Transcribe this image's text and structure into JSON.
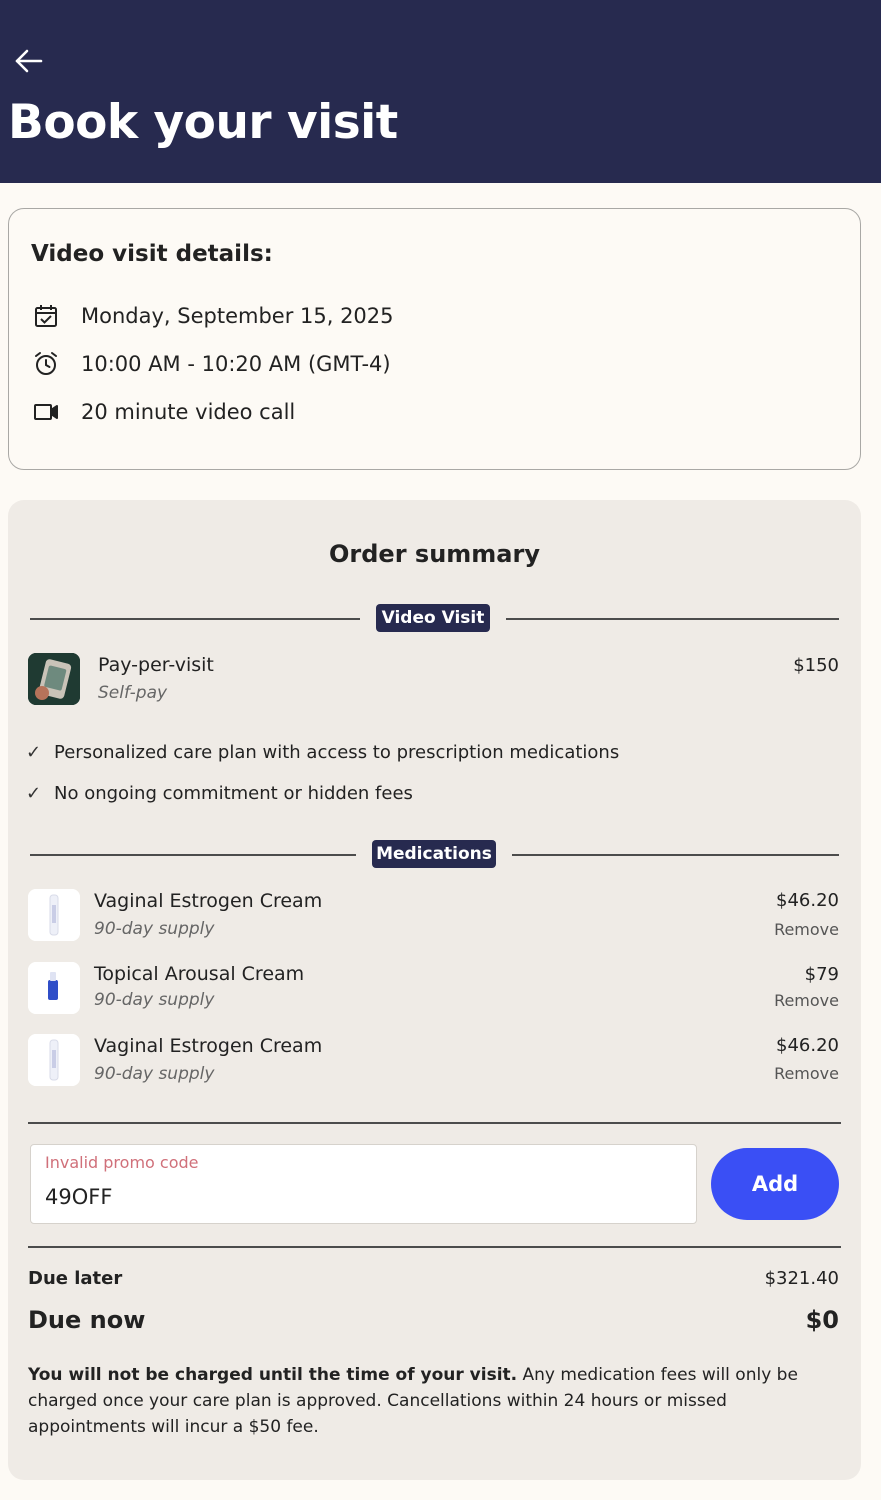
{
  "header": {
    "title": "Book your visit"
  },
  "visit_details": {
    "heading": "Video visit details:",
    "date": "Monday, September 15, 2025",
    "time": "10:00 AM - 10:20 AM (GMT-4)",
    "duration": "20 minute video call"
  },
  "order_summary": {
    "title": "Order summary",
    "video_visit_section": {
      "label": "Video Visit",
      "item": {
        "name": "Pay-per-visit",
        "sub": "Self-pay",
        "price": "$150"
      },
      "benefits": [
        "Personalized care plan with access to prescription medications",
        "No ongoing commitment or hidden fees"
      ]
    },
    "medications_section": {
      "label": "Medications",
      "items": [
        {
          "name": "Vaginal Estrogen Cream",
          "sub": "90-day supply",
          "price": "$46.20",
          "remove": "Remove"
        },
        {
          "name": "Topical Arousal Cream",
          "sub": "90-day supply",
          "price": "$79",
          "remove": "Remove"
        },
        {
          "name": "Vaginal Estrogen Cream",
          "sub": "90-day supply",
          "price": "$46.20",
          "remove": "Remove"
        }
      ]
    },
    "promo": {
      "error": "Invalid promo code",
      "value": "49OFF",
      "add_label": "Add"
    },
    "due_later": {
      "label": "Due later",
      "value": "$321.40"
    },
    "due_now": {
      "label": "Due now",
      "value": "$0"
    },
    "notice": {
      "bold": "You will not be charged until the time of your visit.",
      "rest": " Any medication fees will only be charged once your care plan is approved. Cancellations within 24 hours or missed appointments will incur a $50 fee."
    }
  },
  "colors": {
    "header_bg": "#272a4f",
    "page_bg": "#fdfaf5",
    "summary_bg": "#efebe6",
    "accent_button": "#3a4ff5",
    "error_text": "#d0707a"
  },
  "icons": [
    "back-arrow-icon",
    "calendar-icon",
    "alarm-clock-icon",
    "video-camera-icon",
    "checkmark-icon"
  ]
}
